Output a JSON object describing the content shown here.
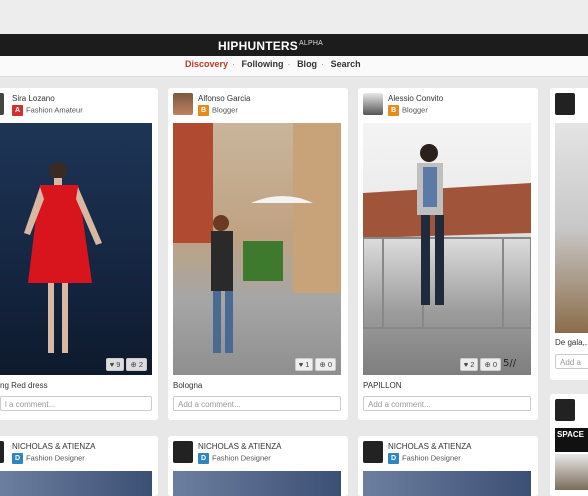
{
  "brand": {
    "name": "HIPHUNTERS",
    "tag": "ALPHA"
  },
  "nav": [
    "Discovery",
    "Following",
    "Blog",
    "Search"
  ],
  "cards": [
    {
      "user": "Sira Lozano",
      "badge": "A",
      "role": "Fashion Amateur",
      "likes": "9",
      "repins": "2",
      "caption": "ng Red dress",
      "comment_placeholder": "l a comment..."
    },
    {
      "user": "Alfonso Garcia",
      "badge": "B",
      "role": "Blogger",
      "likes": "1",
      "repins": "0",
      "caption": "Bologna",
      "comment_placeholder": "Add a comment..."
    },
    {
      "user": "Alessio Convito",
      "badge": "B",
      "role": "Blogger",
      "likes": "2",
      "repins": "0",
      "caption": "PAPILLON",
      "comment_placeholder": "Add a comment..."
    },
    {
      "user": "",
      "badge": "",
      "role": "",
      "likes": "",
      "repins": "",
      "caption": "De gala,...",
      "comment_placeholder": "Add a"
    }
  ],
  "row2": [
    {
      "user": "NICHOLAS & ATIENZA",
      "badge": "D",
      "role": "Fashion Designer"
    },
    {
      "user": "NICHOLAS & ATIENZA",
      "badge": "D",
      "role": "Fashion Designer"
    },
    {
      "user": "NICHOLAS & ATIENZA",
      "badge": "D",
      "role": "Fashion Designer"
    }
  ],
  "row2_partial_ad": "SPACE",
  "icons": {
    "like": "heart-icon",
    "repin": "repin-icon"
  }
}
